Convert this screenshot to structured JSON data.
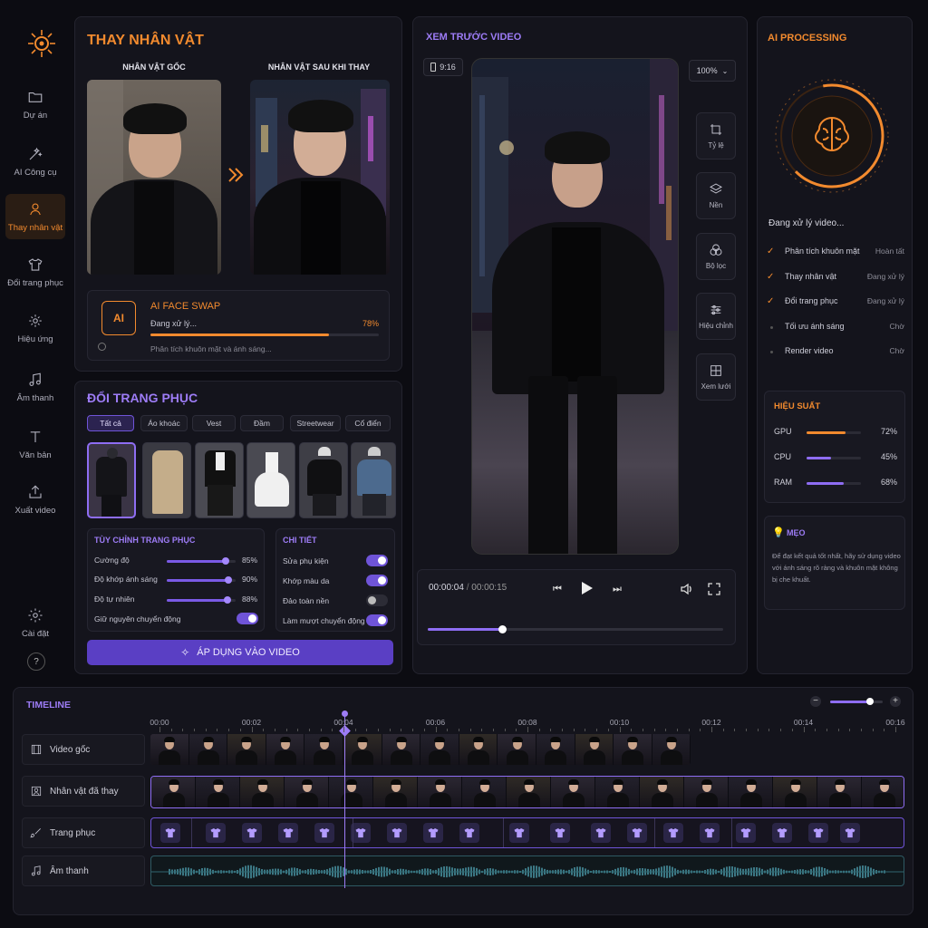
{
  "sidebar": {
    "items": [
      {
        "label": "Dự án",
        "icon": "folder-icon"
      },
      {
        "label": "AI Công cụ",
        "icon": "magic-wand-icon"
      },
      {
        "label": "Thay nhân vật",
        "icon": "person-swap-icon",
        "active": true
      },
      {
        "label": "Đổi trang phục",
        "icon": "shirt-icon"
      },
      {
        "label": "Hiệu ứng",
        "icon": "sparkle-icon"
      },
      {
        "label": "Âm thanh",
        "icon": "music-note-icon"
      },
      {
        "label": "Văn bản",
        "icon": "text-icon"
      },
      {
        "label": "Xuất video",
        "icon": "export-icon"
      }
    ],
    "settings_label": "Cài đặt",
    "help_label": "?"
  },
  "swap": {
    "title": "THAY NHÂN VẬT",
    "original_label": "NHÂN VẬT GỐC",
    "replaced_label": "NHÂN VẬT SAU KHI THAY",
    "ai": {
      "badge": "AI",
      "title": "AI FACE SWAP",
      "status": "Đang xử lý...",
      "percent_label": "78%",
      "progress": 0.78,
      "note": "Phân tích khuôn mặt và ánh sáng..."
    }
  },
  "outfit": {
    "title": "ĐỔI TRANG PHỤC",
    "tabs": [
      "Tất cả",
      "Áo khoác",
      "Vest",
      "Đầm",
      "Streetwear",
      "Cổ điển"
    ],
    "customize": {
      "title": "TÙY CHỈNH TRANG PHỤC",
      "sliders": [
        {
          "label": "Cường độ",
          "value_label": "85%",
          "value": 0.85
        },
        {
          "label": "Độ khớp ánh sáng",
          "value_label": "90%",
          "value": 0.9
        },
        {
          "label": "Độ tự nhiên",
          "value_label": "88%",
          "value": 0.88
        }
      ],
      "keep_motion_label": "Giữ nguyên chuyển động",
      "keep_motion": true
    },
    "details": {
      "title": "CHI TIẾT",
      "options": [
        {
          "label": "Sửa phụ kiện",
          "on": true
        },
        {
          "label": "Khớp màu da",
          "on": true
        },
        {
          "label": "Đảo toàn nền",
          "on": false
        },
        {
          "label": "Làm mượt chuyển động",
          "on": true
        }
      ]
    },
    "apply_label": "ÁP DỤNG VÀO VIDEO"
  },
  "preview": {
    "title": "XEM TRƯỚC VIDEO",
    "ratio": "9:16",
    "zoom": "100%",
    "tools": [
      "Tỷ lệ",
      "Nền",
      "Bộ lọc",
      "Hiệu chỉnh",
      "Xem lưới"
    ],
    "time_current": "00:00:04",
    "time_total": "00:00:15",
    "progress": 0.25
  },
  "processing": {
    "title": "AI PROCESSING",
    "status": "Đang xử lý video...",
    "steps": [
      {
        "label": "Phân tích khuôn mặt",
        "state": "Hoàn tất",
        "done": true
      },
      {
        "label": "Thay nhân vật",
        "state": "Đang xử lý",
        "done": true
      },
      {
        "label": "Đổi trang phục",
        "state": "Đang xử lý",
        "done": true
      },
      {
        "label": "Tối ưu ánh sáng",
        "state": "Chờ",
        "done": false
      },
      {
        "label": "Render video",
        "state": "Chờ",
        "done": false
      }
    ],
    "performance": {
      "title": "HIỆU SUẤT",
      "items": [
        {
          "label": "GPU",
          "value_label": "72%",
          "value": 0.72,
          "color": "#f28a2e"
        },
        {
          "label": "CPU",
          "value_label": "45%",
          "value": 0.45,
          "color": "#8e6df3"
        },
        {
          "label": "RAM",
          "value_label": "68%",
          "value": 0.68,
          "color": "#8e6df3"
        }
      ]
    },
    "tip": {
      "title": "MẸO",
      "text": "Để đạt kết quả tốt nhất, hãy sử dụng video với ánh sáng rõ ràng và khuôn mặt không bị che khuất."
    }
  },
  "timeline": {
    "title": "TIMELINE",
    "ticks": [
      "00:00",
      "00:02",
      "00:04",
      "00:06",
      "00:08",
      "00:10",
      "00:12",
      "00:14",
      "00:16"
    ],
    "tracks": [
      "Video gốc",
      "Nhân vật đã thay",
      "Trang phục",
      "Âm thanh"
    ],
    "zoom": 0.75
  },
  "colors": {
    "accent_orange": "#f28a2e",
    "accent_purple": "#8e6df3",
    "background": "#0c0c12"
  }
}
